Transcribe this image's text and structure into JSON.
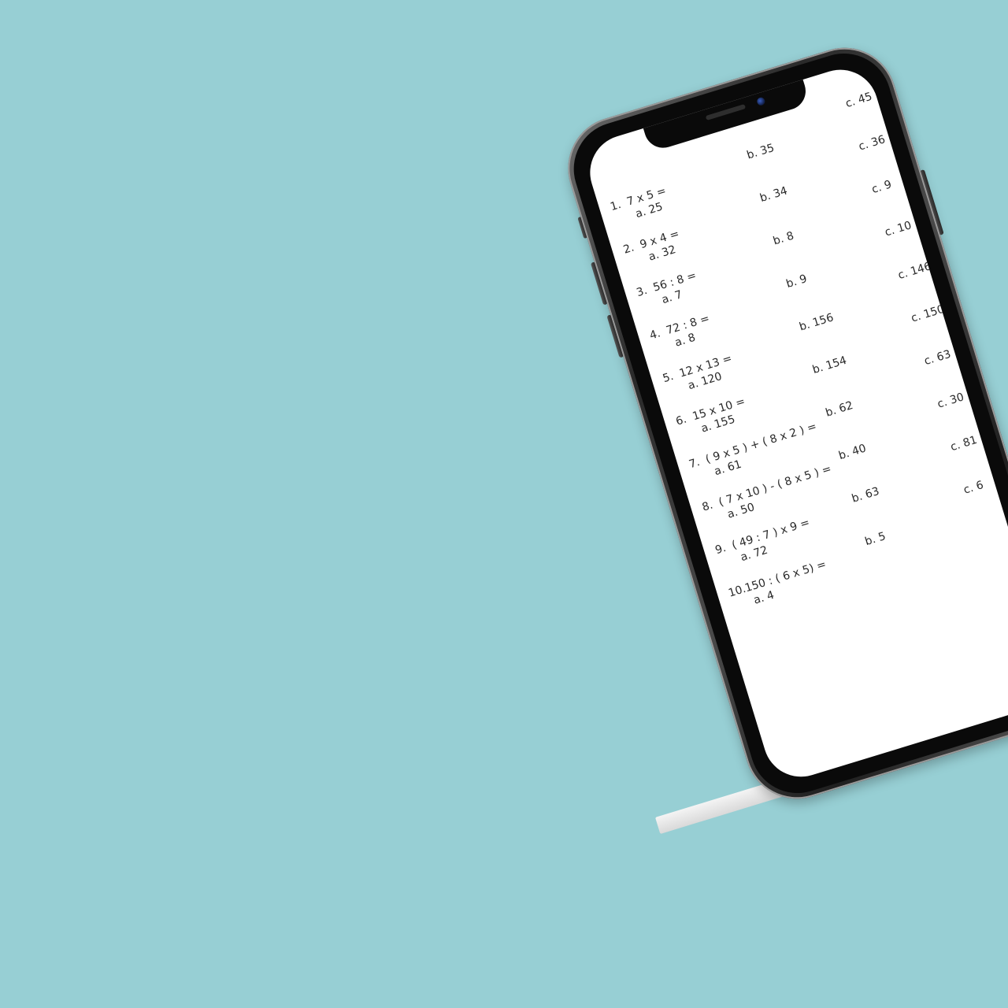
{
  "questions": [
    {
      "num": "1.",
      "expr": "7 x 5 =",
      "a": "a. 25",
      "b": "b. 35",
      "c": "c. 45"
    },
    {
      "num": "2.",
      "expr": "9 x 4 =",
      "a": "a. 32",
      "b": "b. 34",
      "c": "c. 36"
    },
    {
      "num": "3.",
      "expr": "56 : 8 =",
      "a": "a. 7",
      "b": "b. 8",
      "c": "c. 9"
    },
    {
      "num": "4.",
      "expr": "72 : 8 =",
      "a": "a. 8",
      "b": "b. 9",
      "c": "c. 10"
    },
    {
      "num": "5.",
      "expr": "12 x 13 =",
      "a": "a. 120",
      "b": "b. 156",
      "c": "c. 146"
    },
    {
      "num": "6.",
      "expr": "15 x 10 =",
      "a": "a. 155",
      "b": "b. 154",
      "c": "c. 150"
    },
    {
      "num": "7.",
      "expr": "( 9 x 5 ) + ( 8 x 2 ) =",
      "a": "a. 61",
      "b": "b. 62",
      "c": "c. 63"
    },
    {
      "num": "8.",
      "expr": "( 7 x 10 ) - ( 8 x 5 ) =",
      "a": "a. 50",
      "b": "b. 40",
      "c": "c. 30"
    },
    {
      "num": "9.",
      "expr": "( 49 : 7 ) x 9 =",
      "a": "a. 72",
      "b": "b. 63",
      "c": "c. 81"
    },
    {
      "num": "10.",
      "expr": "150 : ( 6 x 5) =",
      "a": "a. 4",
      "b": "b. 5",
      "c": "c. 6"
    }
  ],
  "colors": {
    "background": "#97cfd4",
    "screen": "#ffffff",
    "text": "#2a2a2a"
  }
}
